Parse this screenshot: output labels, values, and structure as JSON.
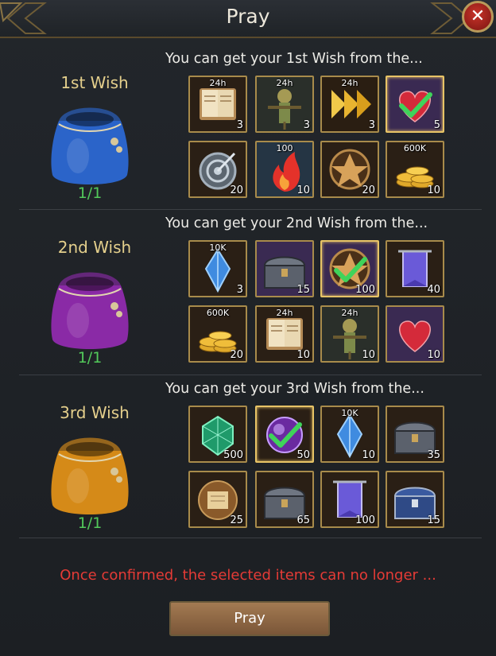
{
  "header": {
    "title": "Pray"
  },
  "wishes": [
    {
      "name": "1st Wish",
      "count": "1/1",
      "bag_color": "#2b64c9",
      "subhead": "You can get your 1st Wish from the...",
      "items": [
        {
          "icon": "book-icon",
          "tag": "24h",
          "qty": "3",
          "bg": "#2a1f15",
          "selected": false
        },
        {
          "icon": "scarecrow-icon",
          "tag": "24h",
          "qty": "3",
          "bg": "#2a2f2a",
          "selected": false
        },
        {
          "icon": "speed-arrows-icon",
          "tag": "24h",
          "qty": "3",
          "bg": "#2a1e12",
          "selected": false
        },
        {
          "icon": "heart-icon",
          "tag": "",
          "qty": "5",
          "bg": "#3a2a52",
          "selected": true
        },
        {
          "icon": "target-shield-icon",
          "tag": "",
          "qty": "20",
          "bg": "#2a1f15",
          "selected": false
        },
        {
          "icon": "fire-icon",
          "tag": "100",
          "qty": "10",
          "bg": "#253544",
          "selected": false
        },
        {
          "icon": "emblem-icon",
          "tag": "",
          "qty": "20",
          "bg": "#2a1f15",
          "selected": false
        },
        {
          "icon": "gold-coins-icon",
          "tag": "600K",
          "qty": "10",
          "bg": "#2a1f15",
          "selected": false
        }
      ]
    },
    {
      "name": "2nd Wish",
      "count": "1/1",
      "bag_color": "#8a2aa6",
      "subhead": "You can get your 2nd Wish from the...",
      "items": [
        {
          "icon": "blue-crystal-icon",
          "tag": "10K",
          "qty": "3",
          "bg": "#2a1f15",
          "selected": false
        },
        {
          "icon": "chest-icon",
          "tag": "",
          "qty": "15",
          "bg": "#3a2a52",
          "selected": false
        },
        {
          "icon": "emblem-icon",
          "tag": "",
          "qty": "100",
          "bg": "#3a2a52",
          "selected": true
        },
        {
          "icon": "banner-icon",
          "tag": "",
          "qty": "40",
          "bg": "#2a1f15",
          "selected": false
        },
        {
          "icon": "gold-coins-icon",
          "tag": "600K",
          "qty": "20",
          "bg": "#2a1f15",
          "selected": false
        },
        {
          "icon": "book-icon",
          "tag": "24h",
          "qty": "10",
          "bg": "#2a1f15",
          "selected": false
        },
        {
          "icon": "scarecrow-icon",
          "tag": "24h",
          "qty": "10",
          "bg": "#2a2f2a",
          "selected": false
        },
        {
          "icon": "heart-icon",
          "tag": "",
          "qty": "10",
          "bg": "#3a2a52",
          "selected": false
        }
      ]
    },
    {
      "name": "3rd Wish",
      "count": "1/1",
      "bag_color": "#d58a18",
      "subhead": "You can get your 3rd Wish from the...",
      "items": [
        {
          "icon": "emerald-icon",
          "tag": "",
          "qty": "500",
          "bg": "#2a1f15",
          "selected": false
        },
        {
          "icon": "purple-orb-icon",
          "tag": "",
          "qty": "50",
          "bg": "#2a1f15",
          "selected": true
        },
        {
          "icon": "blue-crystal-icon",
          "tag": "10K",
          "qty": "10",
          "bg": "#2a1f15",
          "selected": false
        },
        {
          "icon": "chest-icon",
          "tag": "",
          "qty": "35",
          "bg": "#2a1f15",
          "selected": false
        },
        {
          "icon": "scroll-icon",
          "tag": "",
          "qty": "25",
          "bg": "#2a1f15",
          "selected": false
        },
        {
          "icon": "chest-icon",
          "tag": "",
          "qty": "65",
          "bg": "#2a1f15",
          "selected": false
        },
        {
          "icon": "banner-icon",
          "tag": "",
          "qty": "100",
          "bg": "#2a1f15",
          "selected": false
        },
        {
          "icon": "blue-chest-icon",
          "tag": "",
          "qty": "15",
          "bg": "#2a1f15",
          "selected": false
        }
      ]
    }
  ],
  "footer": {
    "warning": "Once confirmed, the selected items can no longer ...",
    "pray_label": "Pray"
  }
}
